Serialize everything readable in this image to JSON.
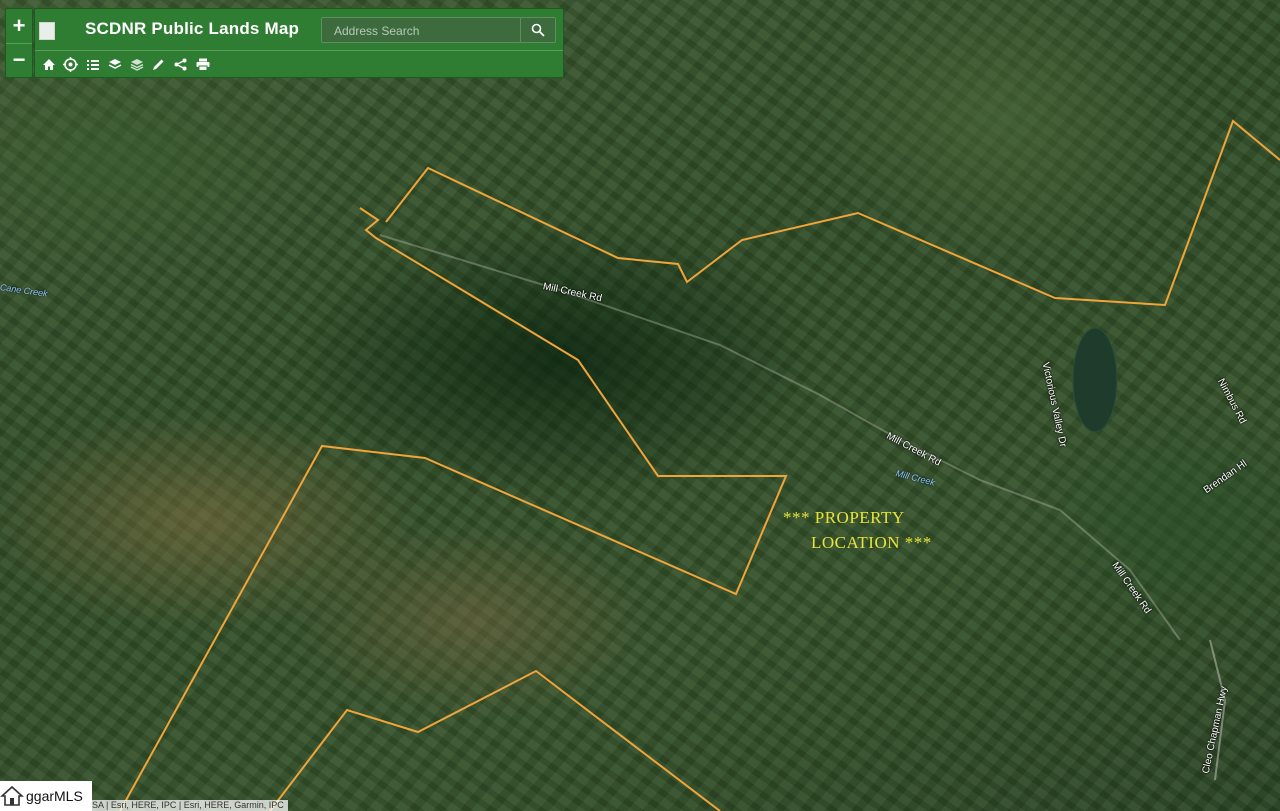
{
  "app": {
    "title": "SCDNR Public Lands Map",
    "search_placeholder": "Address Search"
  },
  "zoom": {
    "in_label": "+",
    "out_label": "−"
  },
  "toolbar": {
    "items": [
      {
        "name": "home-icon"
      },
      {
        "name": "locate-icon"
      },
      {
        "name": "list-icon"
      },
      {
        "name": "layers-icon"
      },
      {
        "name": "basemap-icon"
      },
      {
        "name": "draw-icon"
      },
      {
        "name": "share-icon"
      },
      {
        "name": "print-icon"
      }
    ]
  },
  "annotation": {
    "line1": "*** PROPERTY",
    "line2": "LOCATION ***"
  },
  "labels": {
    "roads": [
      "Mill Creek Rd",
      "Mill Creek Rd",
      "Mill Creek Rd",
      "Victorious Valley Dr",
      "Nimbus Rd",
      "Brendan Hl",
      "Cleo Chapman Hwy"
    ],
    "waters": [
      "Cane Creek",
      "Mill Creek"
    ]
  },
  "attribution": "SA | Esri, HERE, IPC | Esri, HERE, Garmin, IPC",
  "watermark": "ggarMLS",
  "colors": {
    "panel": "#2f7d32",
    "boundary": "#f0a53a",
    "annotation": "#e8e43a"
  }
}
